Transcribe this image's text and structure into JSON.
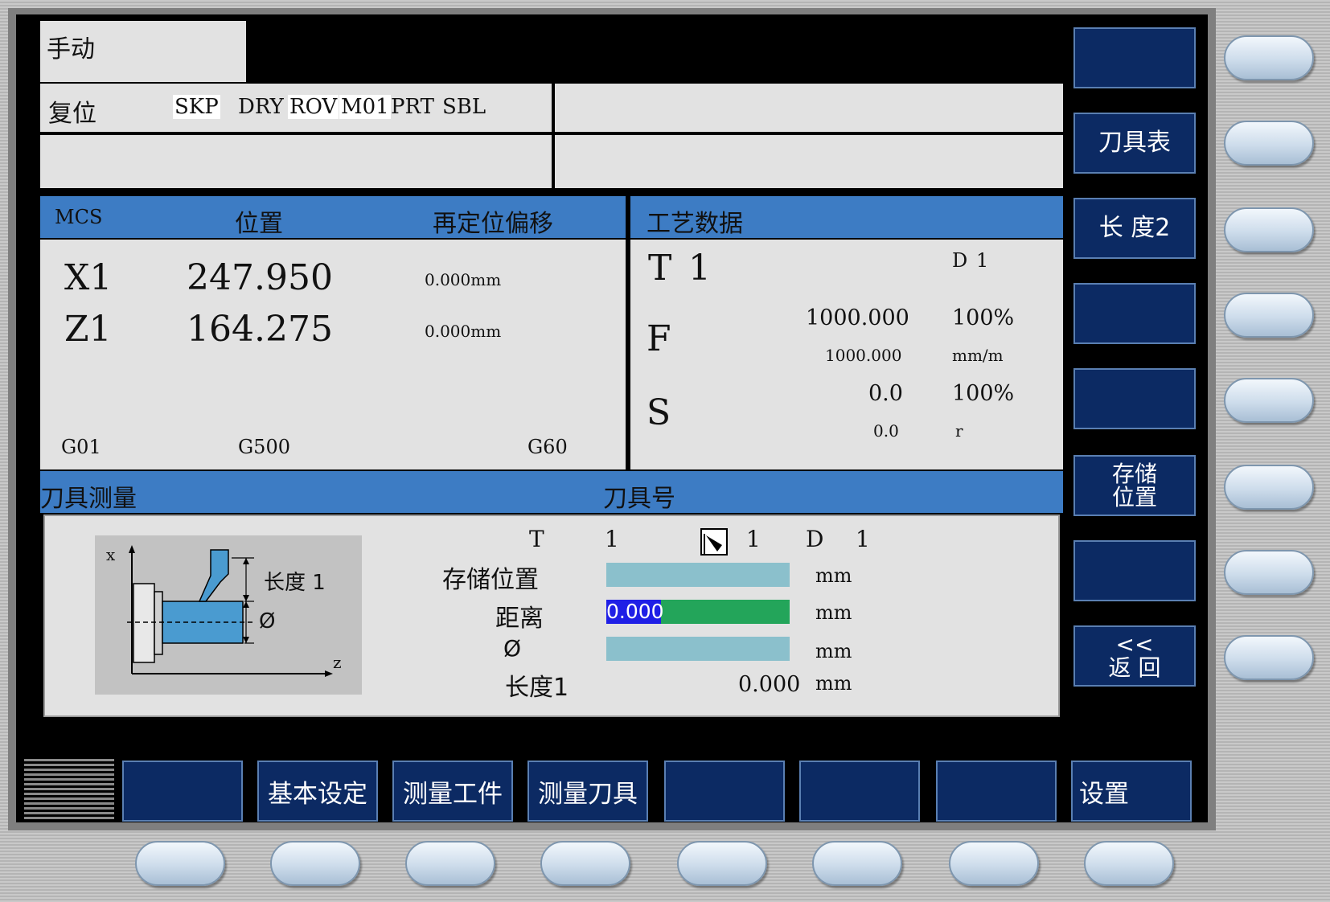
{
  "status": {
    "mode": "手动",
    "reset": "复位",
    "flags": [
      "SKP",
      "DRY",
      "ROV",
      "M01",
      "PRT",
      "SBL"
    ]
  },
  "position": {
    "headers": [
      "MCS",
      "位置",
      "再定位偏移"
    ],
    "axes": [
      {
        "name": "X1",
        "value": "247.950",
        "offset": "0.000mm"
      },
      {
        "name": "Z1",
        "value": "164.275",
        "offset": "0.000mm"
      }
    ],
    "gcodes": [
      "G01",
      "G500",
      "G60"
    ]
  },
  "tech": {
    "title": "工艺数据",
    "t_label": "T",
    "t_value": "1",
    "d_label": "D",
    "d_value": "1",
    "f_label": "F",
    "f_value": "1000.000",
    "f_pct": "100%",
    "f_value2": "1000.000",
    "f_unit": "mm/m",
    "s_label": "S",
    "s_value": "0.0",
    "s_pct": "100%",
    "s_value2": "0.0",
    "s_unit": "r"
  },
  "measure": {
    "title": "刀具测量",
    "tool_header": "刀具号",
    "t_label": "T",
    "t_value": "1",
    "edge_value": "1",
    "d_label": "D",
    "d_value": "1",
    "diagram": {
      "axis_x": "x",
      "axis_z": "z",
      "length_label": "长度 1",
      "diameter_label": "Ø"
    },
    "fields": [
      {
        "label": "存储位置",
        "value": "",
        "unit": "mm"
      },
      {
        "label": "距离",
        "value": "0.000",
        "unit": "mm"
      },
      {
        "label": "Ø",
        "value": "",
        "unit": "mm"
      },
      {
        "label": "长度1",
        "value": "0.000",
        "unit": "mm"
      }
    ]
  },
  "vertical_softkeys": [
    "",
    "刀具表",
    "长 度2",
    "",
    "",
    "存储\n位置",
    "",
    "<<\n返 回"
  ],
  "horizontal_softkeys": [
    "",
    "基本设定",
    "测量工件",
    "测量刀具",
    "",
    "",
    "",
    "设置"
  ],
  "colors": {
    "screen": "#000000",
    "panel": "#e2e2e2",
    "header": "#3d7cc4",
    "softkey": "#0c2a63",
    "field": "#8bc0cc",
    "active_field": "#23a55a",
    "selection": "#1f1fe6"
  }
}
